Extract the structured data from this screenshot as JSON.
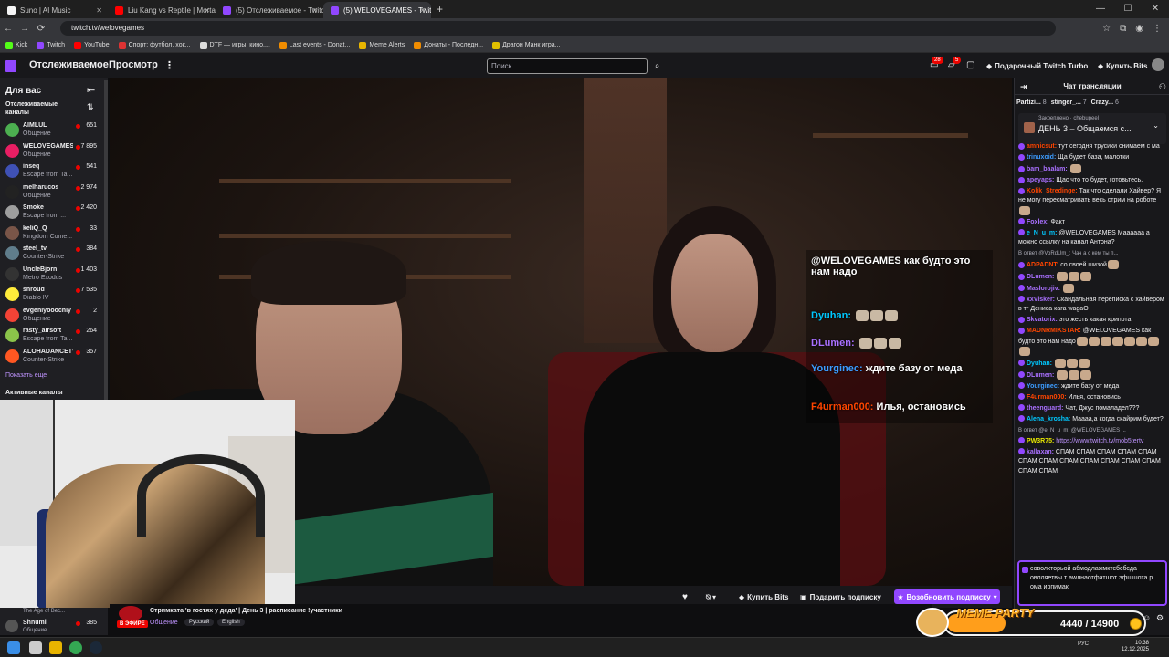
{
  "browser": {
    "tabs": [
      {
        "title": "Suno | AI Music",
        "color": "#f5f5f5",
        "active": false
      },
      {
        "title": "Liu Kang vs Reptile | Mortal Kom",
        "color": "#ff0000",
        "active": false
      },
      {
        "title": "(5) Отслеживаемое - Twitch",
        "color": "#9147ff",
        "active": false
      },
      {
        "title": "(5) WELOVEGAMES - Twitch",
        "color": "#9147ff",
        "active": true
      }
    ],
    "url": "twitch.tv/welovegames",
    "bookmarks": [
      {
        "label": "Kick",
        "color": "#53fc18"
      },
      {
        "label": "Twitch",
        "color": "#9147ff"
      },
      {
        "label": "YouTube",
        "color": "#ff0000"
      },
      {
        "label": "Спорт: футбол, хок...",
        "color": "#d33"
      },
      {
        "label": "DTF — игры, кино,...",
        "color": "#ddd"
      },
      {
        "label": "Last events - Donat...",
        "color": "#f08c00"
      },
      {
        "label": "Meme Alerts",
        "color": "#e8b500"
      },
      {
        "label": "Донаты - Последн...",
        "color": "#f08c00"
      },
      {
        "label": "Драгон Манк игра...",
        "color": "#e0c000"
      }
    ]
  },
  "topnav": {
    "following": "Отслеживаемое",
    "browse": "Просмотр",
    "more": "⋮",
    "search_placeholder": "Поиск",
    "notif_count_1": "28",
    "notif_count_2": "5",
    "turbo": "Подарочный Twitch Turbo",
    "bits": "Купить Bits"
  },
  "sidebar": {
    "title": "Для вас",
    "subtitle": "Отслеживаемые каналы",
    "channels": [
      {
        "name": "AIMLUL",
        "game": "Общение",
        "viewers": "651",
        "color": "#4caf50"
      },
      {
        "name": "WELOVEGAMES",
        "game": "Общение",
        "viewers": "7 895",
        "color": "#e91e63"
      },
      {
        "name": "inseq",
        "game": "Escape from Ta...",
        "viewers": "541",
        "color": "#3f51b5"
      },
      {
        "name": "melharucos",
        "game": "Общение",
        "viewers": "2 974",
        "color": "#222"
      },
      {
        "name": "Smoke",
        "game": "Escape from ...",
        "viewers": "2 420",
        "color": "#9e9e9e"
      },
      {
        "name": "keliQ_Q",
        "game": "Kingdom Come...",
        "viewers": "33",
        "color": "#795548"
      },
      {
        "name": "steel_tv",
        "game": "Counter-Strike",
        "viewers": "384",
        "color": "#607d8b"
      },
      {
        "name": "UncleBjorn",
        "game": "Metro Exodus",
        "viewers": "1 403",
        "color": "#333"
      },
      {
        "name": "shroud",
        "game": "Diablo IV",
        "viewers": "7 535",
        "color": "#ffeb3b"
      },
      {
        "name": "evgeniyboochiy",
        "game": "Общение",
        "viewers": "2",
        "color": "#f44336"
      },
      {
        "name": "rasty_airsoft",
        "game": "Escape from Ta...",
        "viewers": "264",
        "color": "#8bc34a"
      },
      {
        "name": "ALOHADANCETV",
        "game": "Counter-Strike",
        "viewers": "357",
        "color": "#ff5722"
      }
    ],
    "show_more": "Показать еще",
    "active_channels": "Активные каналы",
    "lower_channel": {
      "name": "Shnumi",
      "game": "Общение",
      "viewers": "385",
      "extra": "The Age of Bec..."
    }
  },
  "overlay_chat": [
    {
      "user": "",
      "text": "@WELOVEGAMES как будто это нам надо",
      "ucolor": "#ffffff"
    },
    {
      "user": "Dyuhan:",
      "text": "",
      "ucolor": "#00c8ff",
      "emotes": 3
    },
    {
      "user": "DLumen:",
      "text": "",
      "ucolor": "#a970ff",
      "emotes": 3
    },
    {
      "user": "Yourginec:",
      "text": "ждите базу от меда",
      "ucolor": "#3c9cff"
    },
    {
      "user": "F4urman000:",
      "text": "Илья, остановись",
      "ucolor": "#ff4500"
    }
  ],
  "controls": {
    "buy_bits": "Купить Bits",
    "gift_sub": "Подарить подписку",
    "resub": "Возобновить подписку"
  },
  "stream": {
    "live": "В ЭФИРЕ",
    "title": "Стримката 'в гостях у деда' | День 3 | расписание !участники",
    "category": "Общение",
    "tags": [
      "Русский",
      "English"
    ]
  },
  "chat": {
    "header": "Чат трансляции",
    "leaders": [
      {
        "name": "Partizi...",
        "count": "8"
      },
      {
        "name": "stinger_...",
        "count": "7"
      },
      {
        "name": "Crazy...",
        "count": "6"
      }
    ],
    "pinned_label": "Закреплено",
    "pinned_by": "chebupeel",
    "pinned_text": "ДЕНЬ 3 – Общаемся с...",
    "messages": [
      {
        "user": "amnicsut:",
        "ucolor": "#ff4500",
        "text": "тут сегодня трусики снимаем с ма"
      },
      {
        "user": "trinuxoid:",
        "ucolor": "#3c9cff",
        "text": "Ща будет база, малотки"
      },
      {
        "user": "bam_baalam:",
        "ucolor": "#a970ff",
        "text": "",
        "emotes": 1
      },
      {
        "user": "apeyaps:",
        "ucolor": "#a970ff",
        "text": "Щас что то будет, готовьтесь."
      },
      {
        "user": "Kolik_Stredinge:",
        "ucolor": "#ff4500",
        "text": "Так что сделали Хайвер? Я не могу пересматривать весь стрим на роботе",
        "emotes": 1
      },
      {
        "user": "Foxlex:",
        "ucolor": "#a970ff",
        "text": "Факт"
      },
      {
        "user": "e_N_u_m:",
        "ucolor": "#00c8ff",
        "text": "@WELOVEGAMES Маааааа а можно ссылку на канал Антона?"
      },
      {
        "reply": "В ответ @VoRdUm_: Чач а с кем ты п..."
      },
      {
        "user": "ADPADNT:",
        "ucolor": "#ff4500",
        "text": "со своей шизой",
        "emotes": 1
      },
      {
        "user": "DLumen:",
        "ucolor": "#a970ff",
        "text": "",
        "emotes": 3
      },
      {
        "user": "Maslorojiv:",
        "ucolor": "#a970ff",
        "text": "",
        "emotes": 1
      },
      {
        "user": "xxVisker:",
        "ucolor": "#a970ff",
        "text": "Скандальная переписка с хайвером в тг Дениса кага wagaO"
      },
      {
        "user": "Skvatorix:",
        "ucolor": "#a970ff",
        "text": "это жесть какая крипота"
      },
      {
        "user": "MADNRMIKSTAR:",
        "ucolor": "#ff4500",
        "text": "@WELOVEGAMES как будто это нам надо",
        "emotes": 8
      },
      {
        "user": "Dyuhan:",
        "ucolor": "#00c8ff",
        "text": "",
        "emotes": 3
      },
      {
        "user": "DLumen:",
        "ucolor": "#a970ff",
        "text": "",
        "emotes": 3
      },
      {
        "user": "Yourginec:",
        "ucolor": "#3c9cff",
        "text": "ждите базу от меда"
      },
      {
        "user": "F4urman000:",
        "ucolor": "#ff4500",
        "text": "Илья, остановись"
      },
      {
        "user": "theenguard:",
        "ucolor": "#a970ff",
        "text": "Чат, Джус помаладел???"
      },
      {
        "user": "Alena_krosha:",
        "ucolor": "#00c8ff",
        "text": "Маааа,а когда скайрим будет?"
      },
      {
        "reply": "В ответ @e_N_u_m: @WELOVEGAMES ..."
      },
      {
        "user": "PW3R75:",
        "ucolor": "#e8e800",
        "text": "",
        "link": "https://www.twitch.tv/mob5tertv"
      },
      {
        "user": "kallaxan:",
        "ucolor": "#a970ff",
        "text": "СПАМ СПАМ СПАМ СПАМ СПАМ СПАМ СПАМ СПАМ СПАМ СПАМ СПАМ СПАМ СПАМ СПАМ"
      }
    ],
    "input_text": "соволкторьой абмодлажмктсбсбсда овлляетвы т аwлнаотфатшот эфшшота р ома ирпимак"
  },
  "meme_party": {
    "title": "MEME PARTY",
    "value": "4440 / 14900",
    "progress": 0.298
  },
  "taskbar": {
    "lang": "РУС",
    "time": "10:38",
    "date": "12.12.2025"
  }
}
